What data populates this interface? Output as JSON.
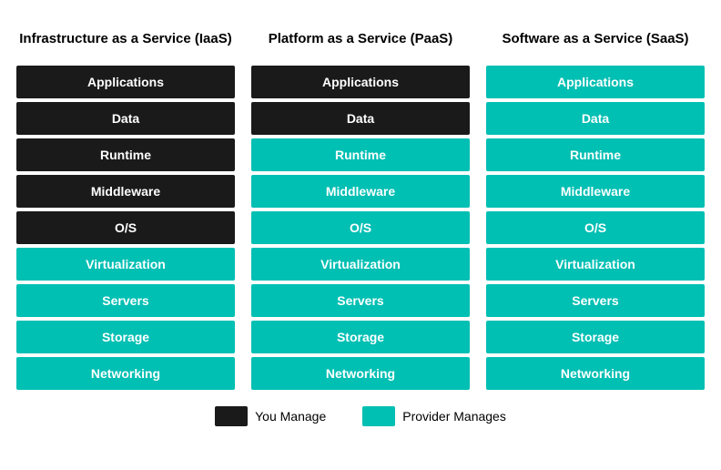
{
  "columns": [
    {
      "id": "iaas",
      "header": "Infrastructure as a Service (IaaS)",
      "rows": [
        {
          "label": "Applications",
          "type": "dark"
        },
        {
          "label": "Data",
          "type": "dark"
        },
        {
          "label": "Runtime",
          "type": "dark"
        },
        {
          "label": "Middleware",
          "type": "dark"
        },
        {
          "label": "O/S",
          "type": "dark"
        },
        {
          "label": "Virtualization",
          "type": "teal"
        },
        {
          "label": "Servers",
          "type": "teal"
        },
        {
          "label": "Storage",
          "type": "teal"
        },
        {
          "label": "Networking",
          "type": "teal"
        }
      ]
    },
    {
      "id": "paas",
      "header": "Platform as a Service (PaaS)",
      "rows": [
        {
          "label": "Applications",
          "type": "dark"
        },
        {
          "label": "Data",
          "type": "dark"
        },
        {
          "label": "Runtime",
          "type": "teal"
        },
        {
          "label": "Middleware",
          "type": "teal"
        },
        {
          "label": "O/S",
          "type": "teal"
        },
        {
          "label": "Virtualization",
          "type": "teal"
        },
        {
          "label": "Servers",
          "type": "teal"
        },
        {
          "label": "Storage",
          "type": "teal"
        },
        {
          "label": "Networking",
          "type": "teal"
        }
      ]
    },
    {
      "id": "saas",
      "header": "Software as a Service (SaaS)",
      "rows": [
        {
          "label": "Applications",
          "type": "teal"
        },
        {
          "label": "Data",
          "type": "teal"
        },
        {
          "label": "Runtime",
          "type": "teal"
        },
        {
          "label": "Middleware",
          "type": "teal"
        },
        {
          "label": "O/S",
          "type": "teal"
        },
        {
          "label": "Virtualization",
          "type": "teal"
        },
        {
          "label": "Servers",
          "type": "teal"
        },
        {
          "label": "Storage",
          "type": "teal"
        },
        {
          "label": "Networking",
          "type": "teal"
        }
      ]
    }
  ],
  "legend": {
    "items": [
      {
        "label": "You Manage",
        "type": "dark"
      },
      {
        "label": "Provider Manages",
        "type": "teal"
      }
    ]
  }
}
